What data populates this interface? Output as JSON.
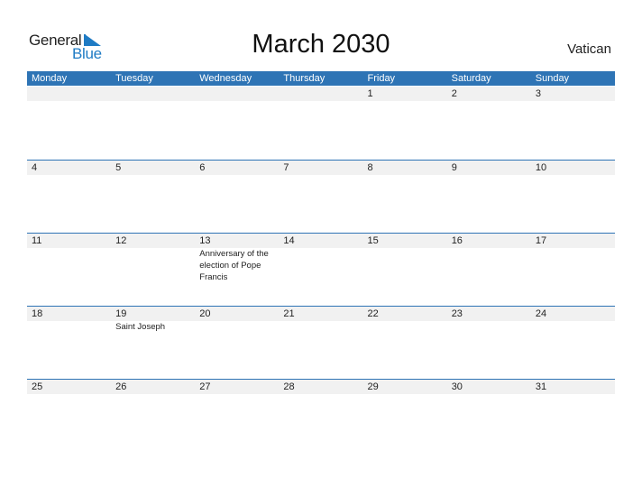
{
  "logo": {
    "word1": "General",
    "word2": "Blue"
  },
  "title": "March 2030",
  "country": "Vatican",
  "colors": {
    "header_bg": "#2e74b5",
    "band_bg": "#f1f1f1",
    "logo_blue": "#1f7bc4"
  },
  "weekdays": [
    "Monday",
    "Tuesday",
    "Wednesday",
    "Thursday",
    "Friday",
    "Saturday",
    "Sunday"
  ],
  "weeks": [
    {
      "days": [
        "",
        "",
        "",
        "",
        "1",
        "2",
        "3"
      ],
      "events": [
        "",
        "",
        "",
        "",
        "",
        "",
        ""
      ]
    },
    {
      "days": [
        "4",
        "5",
        "6",
        "7",
        "8",
        "9",
        "10"
      ],
      "events": [
        "",
        "",
        "",
        "",
        "",
        "",
        ""
      ]
    },
    {
      "days": [
        "11",
        "12",
        "13",
        "14",
        "15",
        "16",
        "17"
      ],
      "events": [
        "",
        "",
        "Anniversary of the election of Pope Francis",
        "",
        "",
        "",
        ""
      ]
    },
    {
      "days": [
        "18",
        "19",
        "20",
        "21",
        "22",
        "23",
        "24"
      ],
      "events": [
        "",
        "Saint Joseph",
        "",
        "",
        "",
        "",
        ""
      ]
    },
    {
      "days": [
        "25",
        "26",
        "27",
        "28",
        "29",
        "30",
        "31"
      ],
      "events": [
        "",
        "",
        "",
        "",
        "",
        "",
        ""
      ]
    }
  ]
}
